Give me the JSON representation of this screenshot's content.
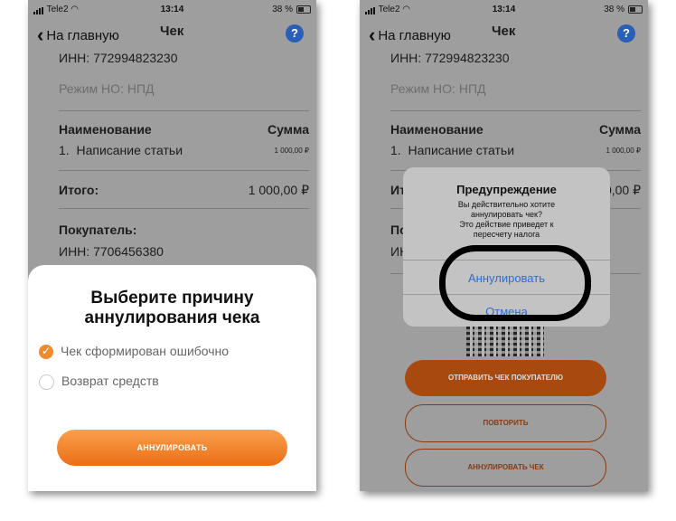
{
  "status": {
    "carrier": "Tele2",
    "time": "13:14",
    "battery": "38 %"
  },
  "nav": {
    "back_label": "На главную",
    "title": "Чек",
    "help": "?"
  },
  "receipt": {
    "inn": "ИНН: 772994823230",
    "mode": "Режим НО: НПД",
    "col_name": "Наименование",
    "col_sum": "Сумма",
    "item_index": "1.",
    "item_name": "Написание статьи",
    "item_sum": "1 000,00 ₽",
    "total_label": "Итого:",
    "total_value": "1 000,00 ₽",
    "buyer_label": "Покупатель:",
    "buyer_inn": "ИНН: 7706456380"
  },
  "sheet": {
    "title_line1": "Выберите причину",
    "title_line2": "аннулирования чека",
    "options": [
      "Чек сформирован ошибочно",
      "Возврат средств"
    ],
    "selected_index": 0,
    "button": "АННУЛИРОВАТЬ"
  },
  "alert": {
    "title": "Предупреждение",
    "message": [
      "Вы действительно хотите",
      "аннулировать чек?",
      "Это действие приведет к",
      "пересчету налога"
    ],
    "action": "Аннулировать",
    "cancel": "Отмена"
  },
  "actions": {
    "send": "ОТПРАВИТЬ ЧЕК ПОКУПАТЕЛЮ",
    "repeat": "ПОВТОРИТЬ",
    "cancel_receipt": "АННУЛИРОВАТЬ ЧЕК"
  },
  "colors": {
    "accent": "#f28a2e",
    "link": "#2f6bd6",
    "help": "#2a5fb8"
  }
}
